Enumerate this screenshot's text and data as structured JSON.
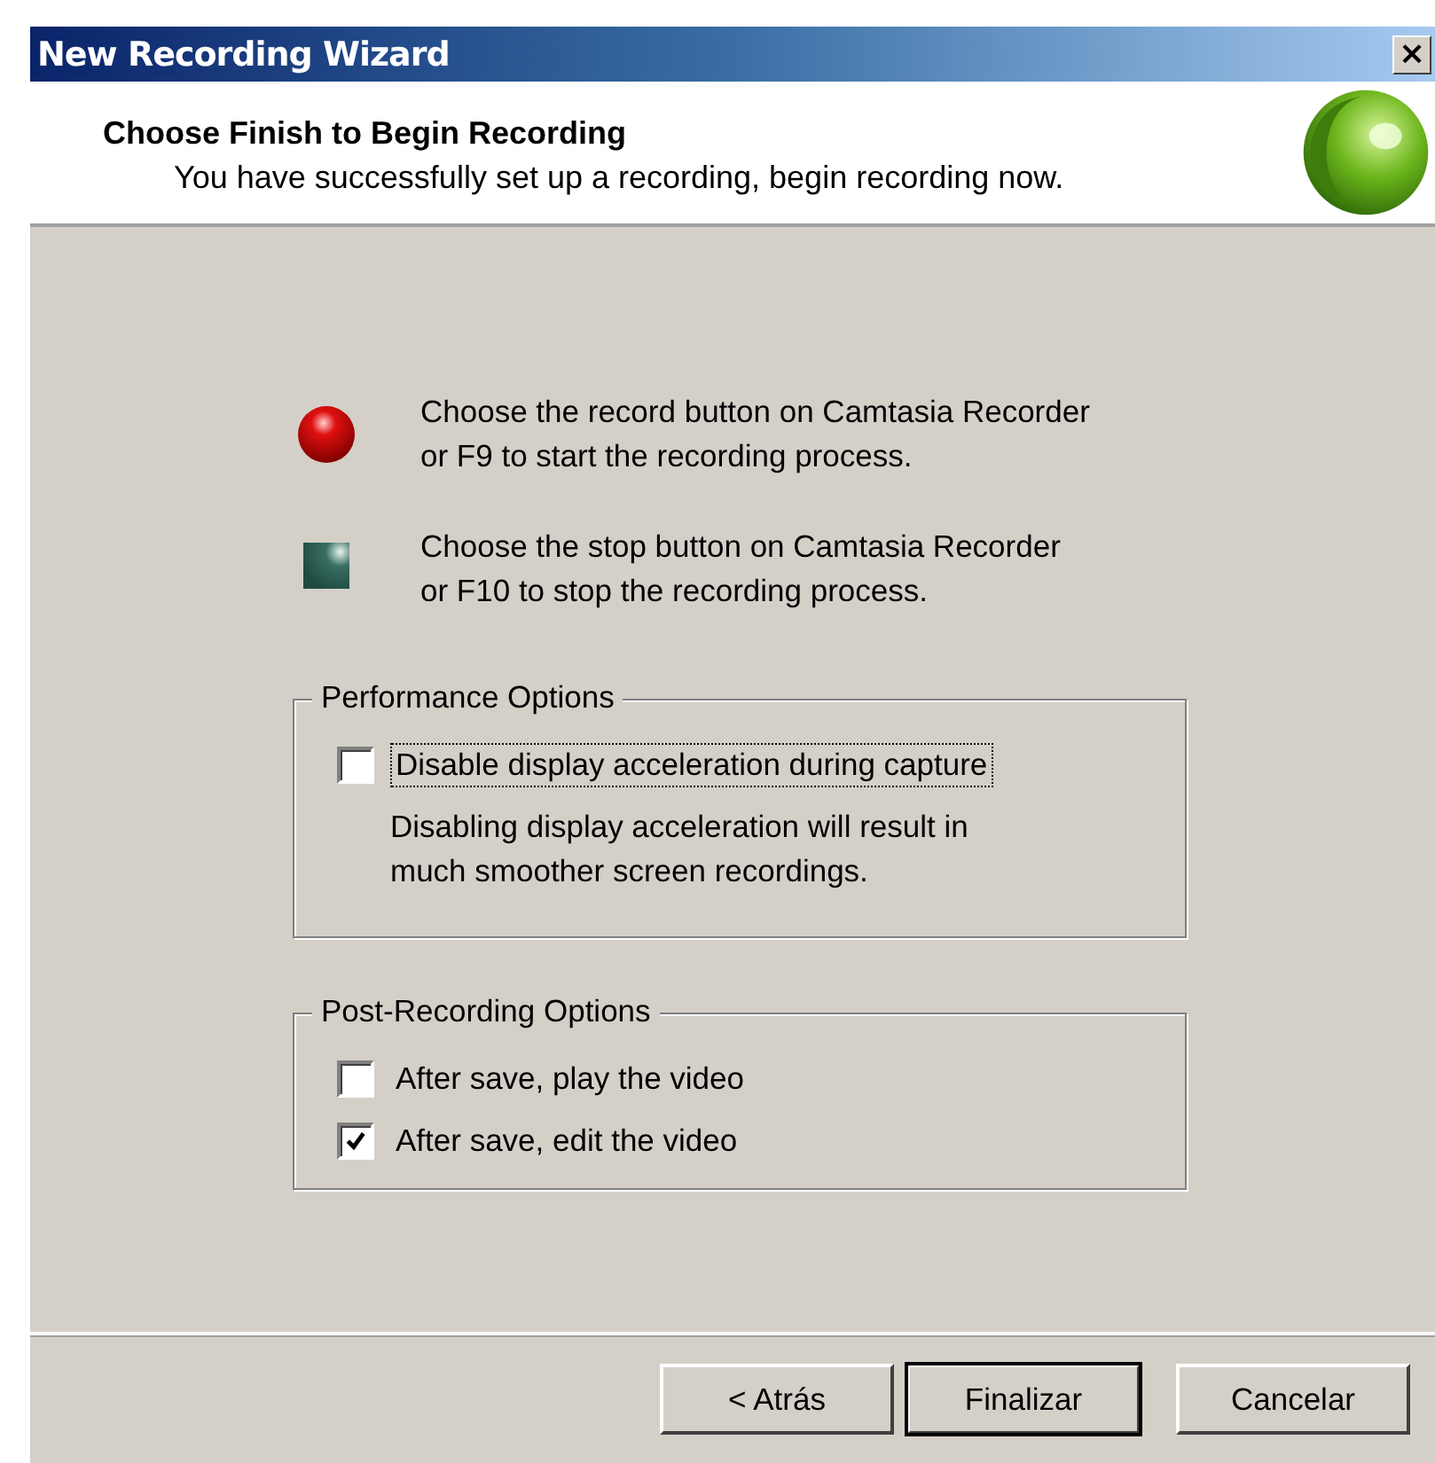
{
  "window": {
    "title": "New Recording Wizard",
    "close": "×"
  },
  "header": {
    "title": "Choose Finish to Begin Recording",
    "subtitle": "You have successfully set up a recording, begin recording now."
  },
  "instructions": [
    {
      "kind": "record",
      "lines": [
        "Choose the record button on Camtasia Recorder",
        "or F9 to start the recording process."
      ]
    },
    {
      "kind": "stop",
      "lines": [
        "Choose the stop button on Camtasia Recorder",
        "or F10 to stop the recording process."
      ]
    }
  ],
  "groups": [
    {
      "title": "Performance Options",
      "options": [
        {
          "label": "Disable display acceleration during capture",
          "checked": false,
          "focused": true
        }
      ],
      "description": [
        "Disabling display acceleration will result in",
        "much smoother screen recordings."
      ]
    },
    {
      "title": "Post-Recording Options",
      "options": [
        {
          "label": "After save, play the video",
          "checked": false,
          "focused": false
        },
        {
          "label": "After save, edit the video",
          "checked": true,
          "focused": false
        }
      ]
    }
  ],
  "buttons": [
    {
      "label": "< Atrás",
      "default": false
    },
    {
      "label": "Finalizar",
      "default": true
    },
    {
      "label": "Cancelar",
      "default": false
    }
  ]
}
